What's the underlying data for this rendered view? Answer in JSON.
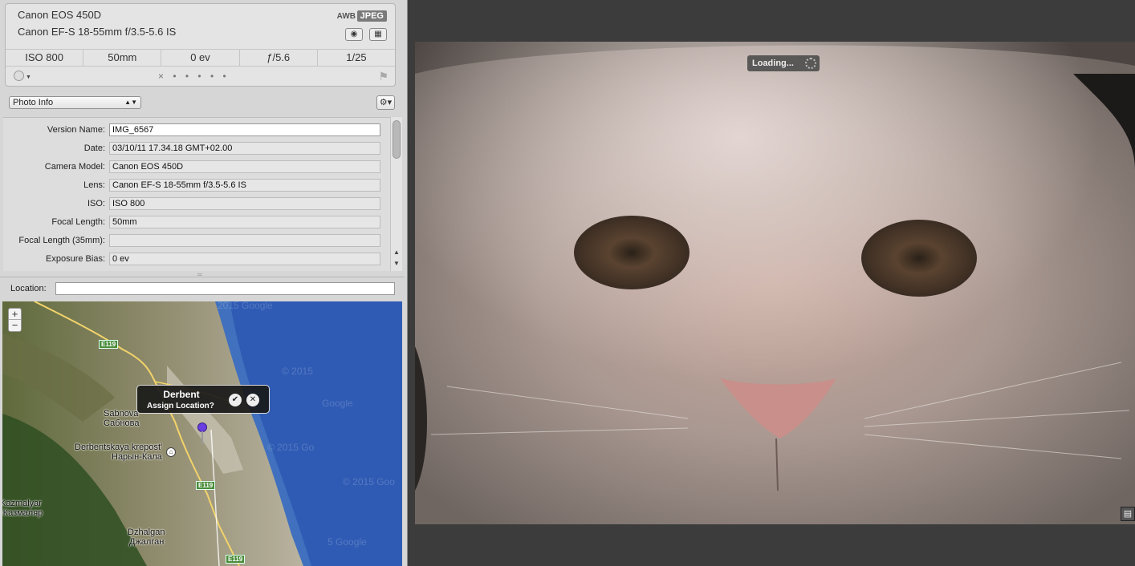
{
  "camera": {
    "model": "Canon EOS 450D",
    "lens": "Canon EF-S 18-55mm f/3.5-5.6 IS",
    "white_balance": "AWB",
    "format": "JPEG",
    "iso": "ISO 800",
    "focal": "50mm",
    "exposure": "0 ev",
    "aperture": "ƒ/5.6",
    "shutter": "1/25",
    "rating_marks": "× • • • • •"
  },
  "toolbar": {
    "inspector_select": "Photo Info",
    "gear": "⚙▾"
  },
  "fields": [
    {
      "label": "Version Name:",
      "value": "IMG_6567"
    },
    {
      "label": "Date:",
      "value": "03/10/11 17.34.18 GMT+02.00"
    },
    {
      "label": "Camera Model:",
      "value": "Canon EOS 450D"
    },
    {
      "label": "Lens:",
      "value": "Canon EF-S 18-55mm f/3.5-5.6 IS"
    },
    {
      "label": "ISO:",
      "value": "ISO 800"
    },
    {
      "label": "Focal Length:",
      "value": "50mm"
    },
    {
      "label": "Focal Length (35mm):",
      "value": ""
    },
    {
      "label": "Exposure Bias:",
      "value": "0 ev"
    }
  ],
  "location": {
    "label": "Location:",
    "value": ""
  },
  "map": {
    "zoom_in": "+",
    "zoom_out": "−",
    "callout_title": "Derbent",
    "callout_subtitle": "Assign Location?",
    "confirm": "✔",
    "cancel": "✕",
    "labels": {
      "sabnova": "Sabnova",
      "sabnova_ru": "Сабнова",
      "derbentskaya": "Derbentskaya krepost'",
      "naryn": "Нарын-Кала",
      "kazmalyar": "Kazmalyar",
      "kazmalyar_ru": "-Казмаляр",
      "dzhalgan": "Dzhalgan",
      "dzhalgan_ru": "Джалган"
    },
    "roads": [
      "E119",
      "E119",
      "E119"
    ],
    "watermarks": {
      "google_1": "2015 Google",
      "c2015": "© 2015",
      "google_2": "Google",
      "c2015g": "© 2015 Go",
      "c2015g2": "© 2015 Goo",
      "google_3": "5 Google"
    }
  },
  "viewer": {
    "loading_text": "Loading..."
  },
  "colors": {
    "panel_bg": "#d6d6d6",
    "viewer_bg": "#3c3c3c",
    "pin": "#6a3ee0",
    "road_shield": "#4a8c3a"
  }
}
